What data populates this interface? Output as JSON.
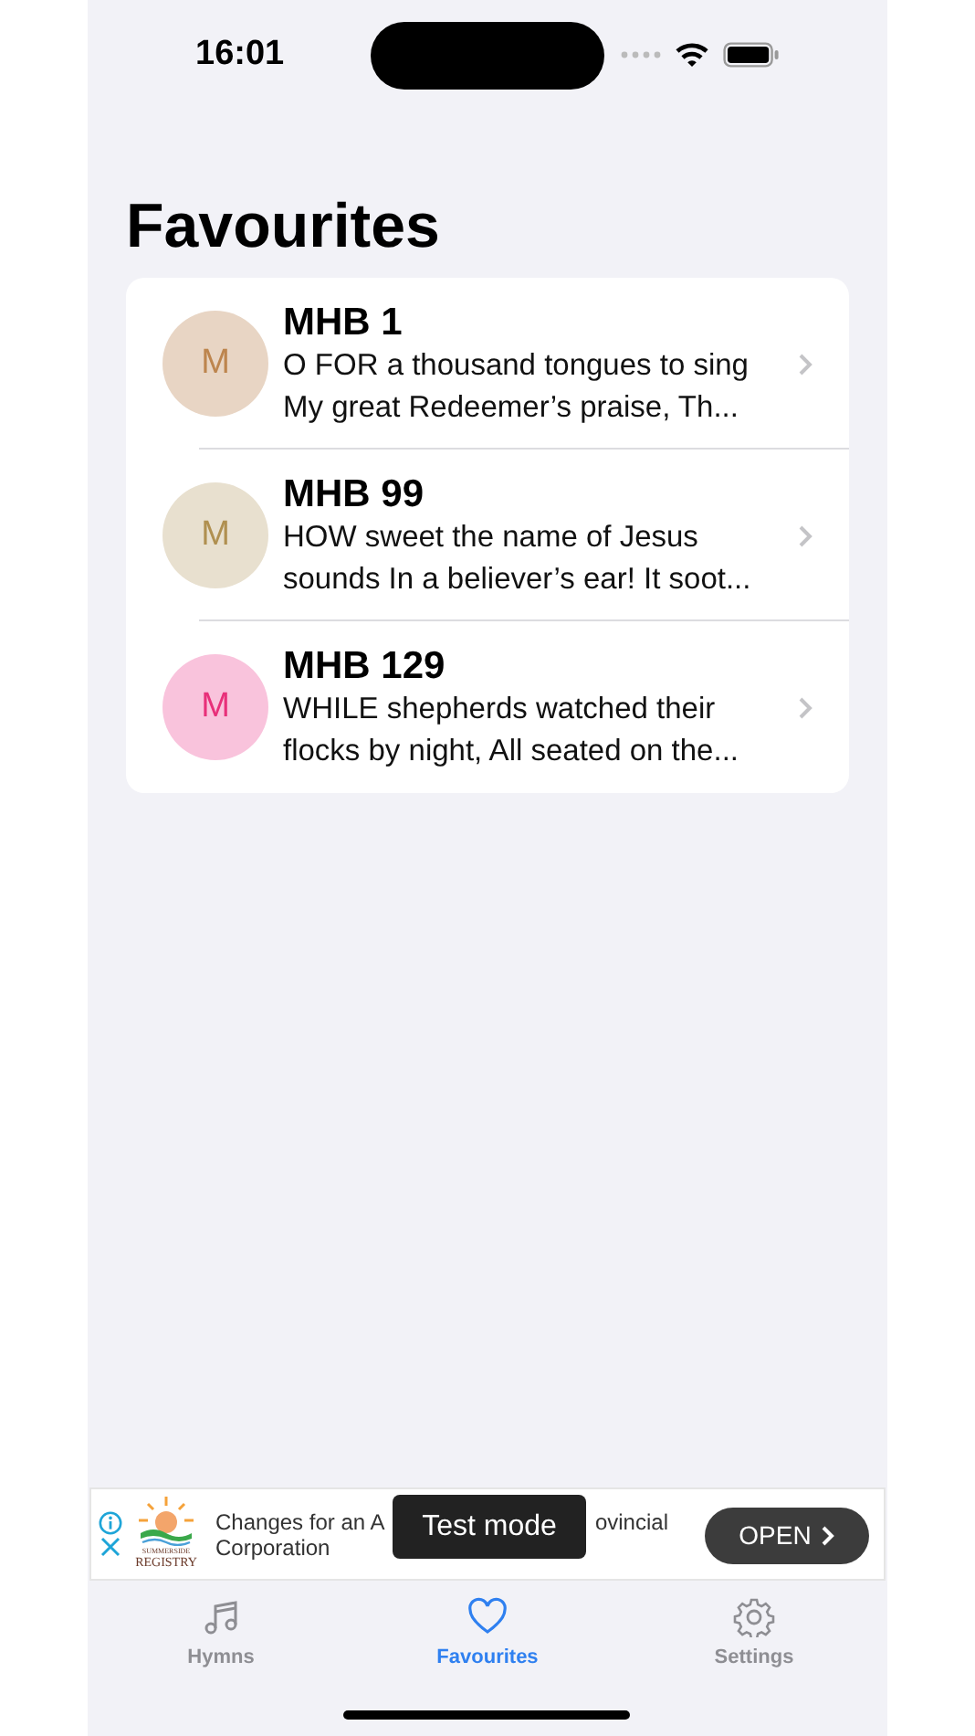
{
  "status_bar": {
    "time": "16:01"
  },
  "title": "Favourites",
  "hymns": [
    {
      "initial": "M",
      "color": "#e8d5c4",
      "title": "MHB 1",
      "lines": [
        "O FOR a thousand tongues to sing",
        "My great Redeemer’s praise,  Th..."
      ]
    },
    {
      "initial": "M",
      "color": "#e8e0cf",
      "title": "MHB 99",
      "lines": [
        "HOW sweet the name of Jesus",
        "sounds In a believer’s ear! It soot..."
      ]
    },
    {
      "initial": "M",
      "color": "#f9c3dc",
      "title": "MHB 129",
      "lines": [
        "WHILE shepherds watched their",
        "flocks by night, All seated on the..."
      ]
    }
  ],
  "ad": {
    "logo_lines": [
      "SUMMERSIDE",
      "REGISTRY"
    ],
    "text_left": "Changes for an A",
    "text_right": "ovincial",
    "text_line2": "Corporation",
    "button": "OPEN",
    "toast": "Test mode"
  },
  "tabs": [
    {
      "label": "Hymns",
      "kind": "music",
      "selected": false
    },
    {
      "label": "Favourites",
      "kind": "heart",
      "selected": true
    },
    {
      "label": "Settings",
      "kind": "gear",
      "selected": false
    }
  ]
}
